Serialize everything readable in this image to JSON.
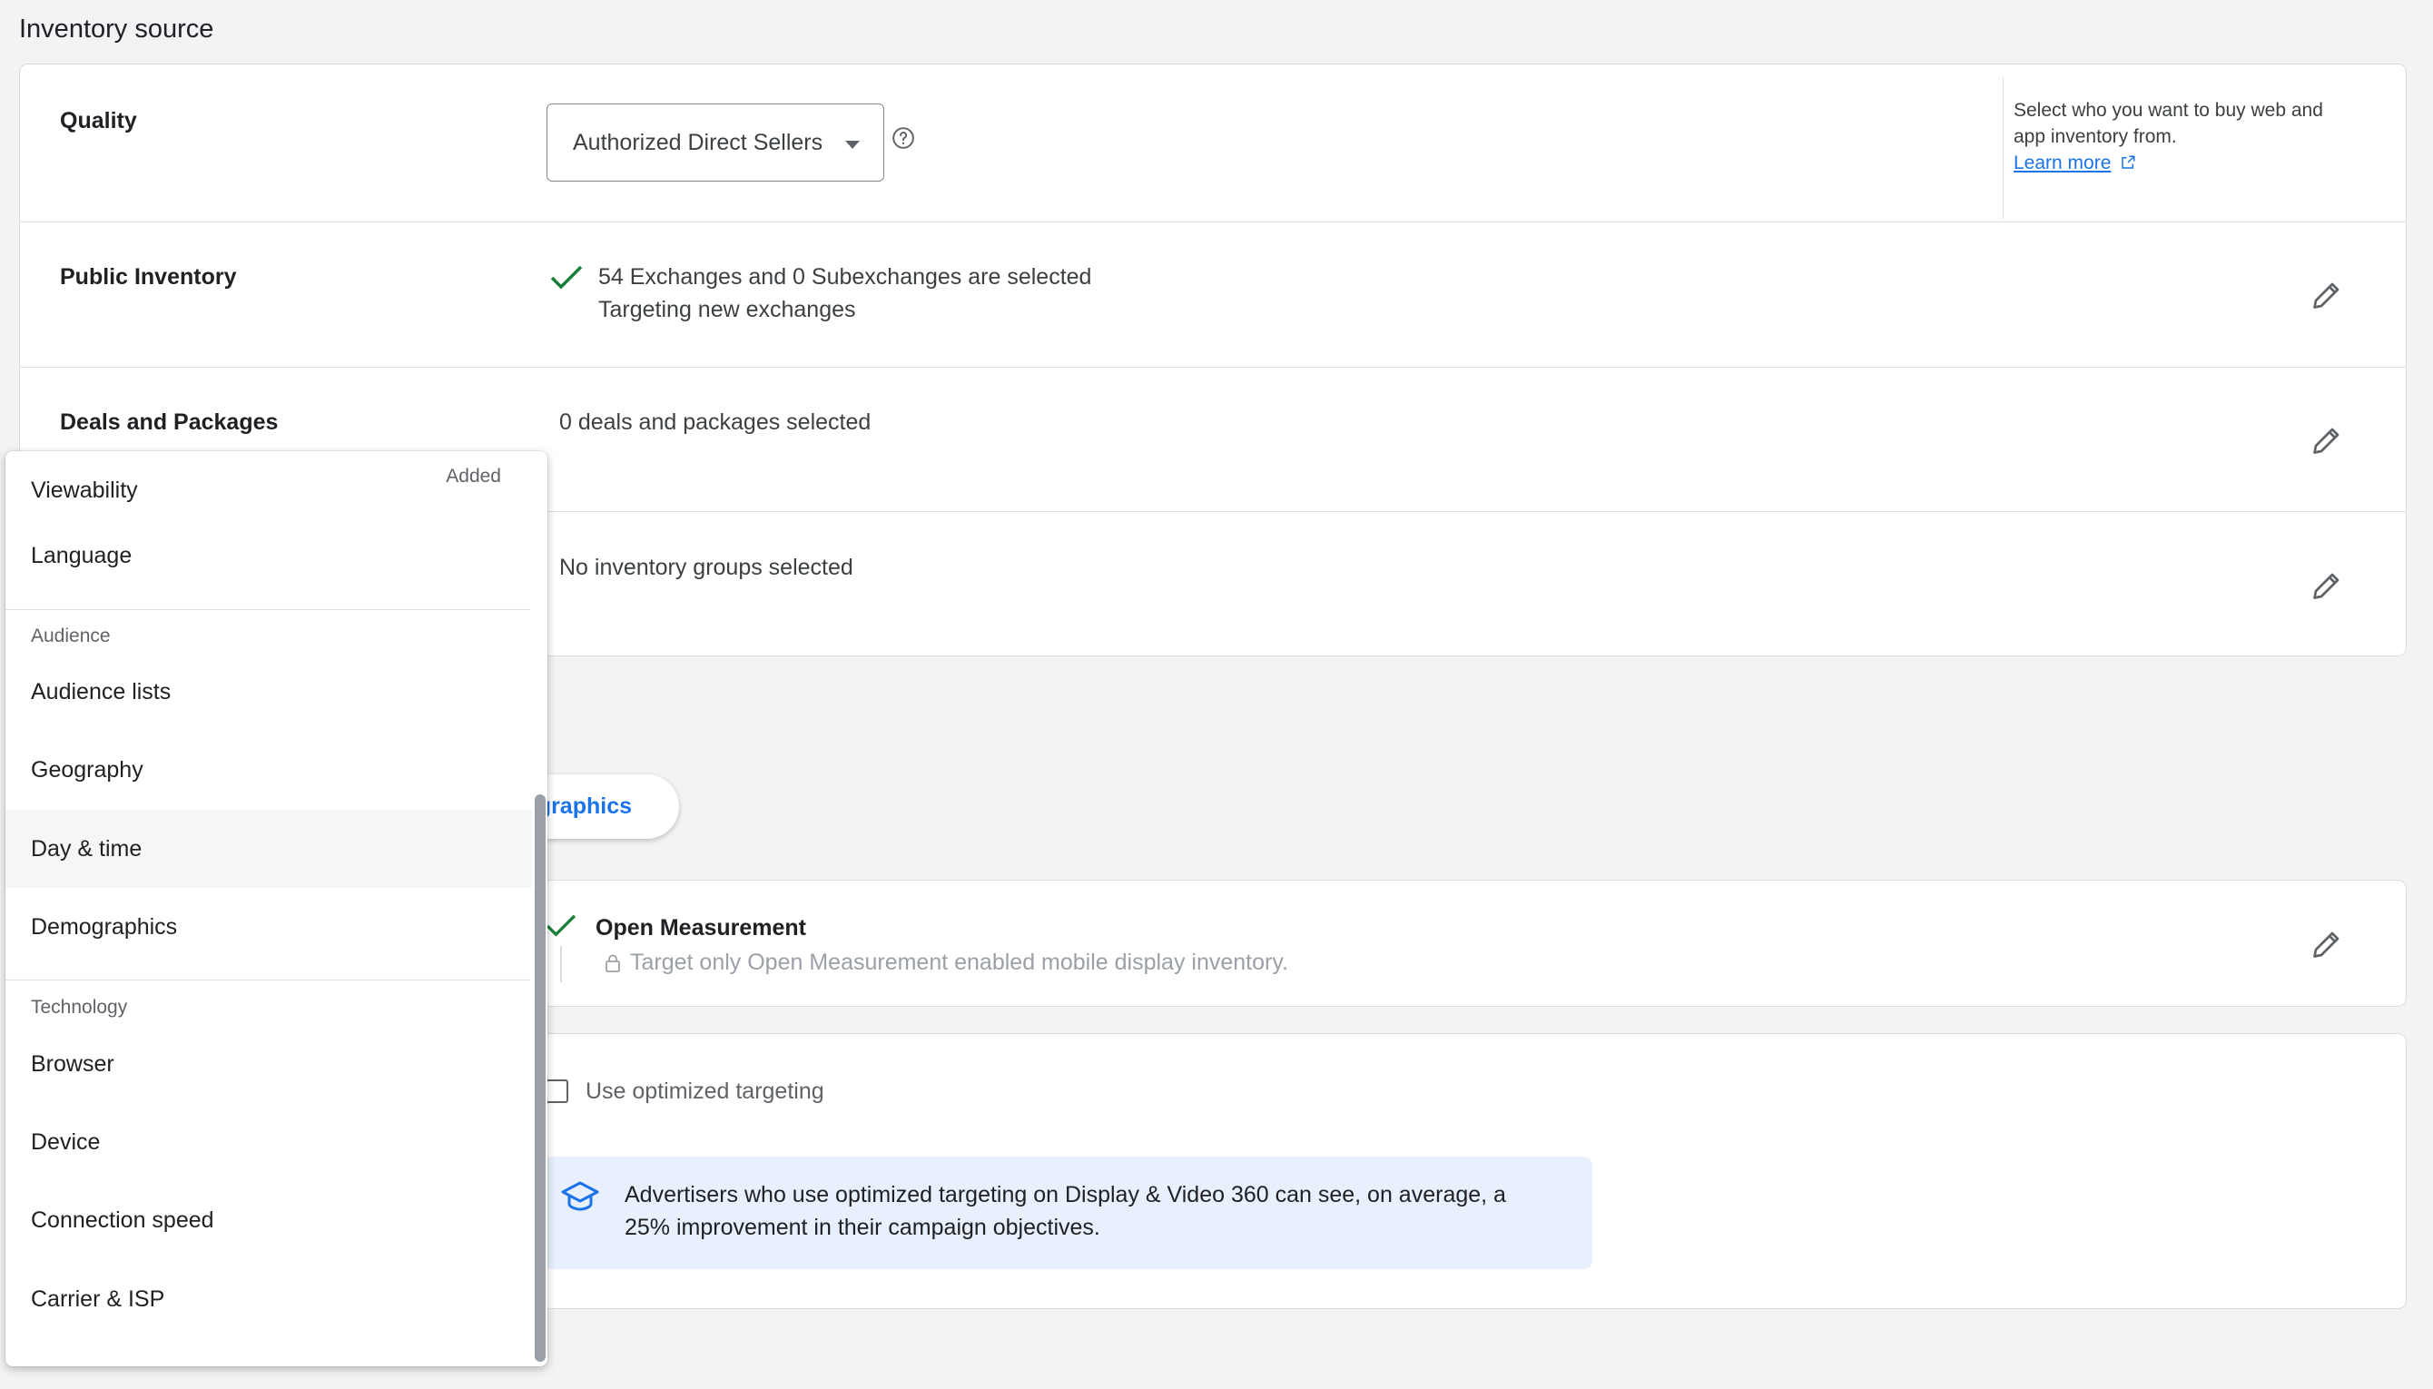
{
  "section_title": "Inventory source",
  "quality": {
    "label": "Quality",
    "dropdown_value": "Authorized Direct Sellers",
    "help_text": "Select who you want to buy web and app inventory from.",
    "learn_more": "Learn more"
  },
  "public_inventory": {
    "label": "Public Inventory",
    "line1": "54 Exchanges and 0 Subexchanges are selected",
    "line2": "Targeting new exchanges"
  },
  "deals": {
    "label": "Deals and Packages",
    "value": "0 deals and packages selected"
  },
  "groups": {
    "value": "No inventory groups selected"
  },
  "tab_partial": "graphics",
  "viewability": {
    "title": "Open Measurement",
    "subtitle": "Target only Open Measurement enabled mobile display inventory."
  },
  "optimized": {
    "checkbox_label": "Use optimized targeting",
    "banner_text": "Advertisers who use optimized targeting on Display & Video 360 can see, on average, a 25% improvement in their campaign objectives."
  },
  "menu": {
    "item_viewability": "Viewability",
    "added_badge": "Added",
    "item_language": "Language",
    "group_audience": "Audience",
    "item_audience_lists": "Audience lists",
    "item_geography": "Geography",
    "item_day_time": "Day & time",
    "item_demographics": "Demographics",
    "group_technology": "Technology",
    "item_browser": "Browser",
    "item_device": "Device",
    "item_connection_speed": "Connection speed",
    "item_carrier_isp": "Carrier & ISP"
  },
  "colors": {
    "accent": "#1a73e8",
    "check_green": "#188038",
    "banner_bg": "#e8f0fe"
  }
}
